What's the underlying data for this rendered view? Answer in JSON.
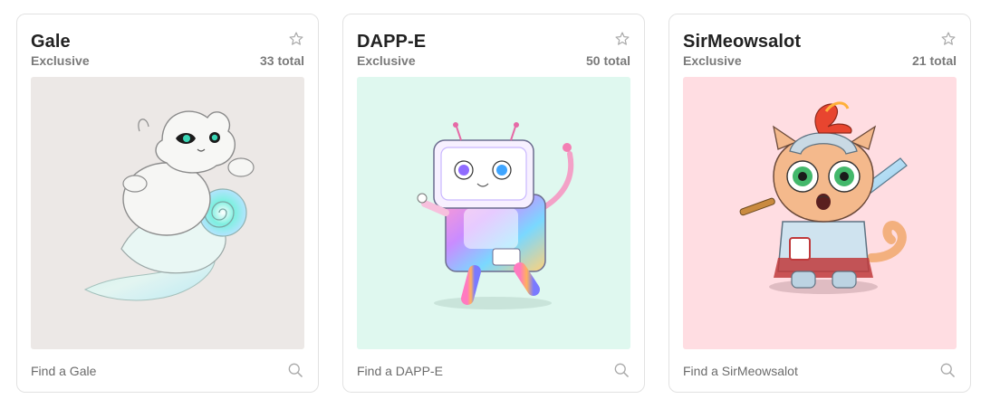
{
  "cards": [
    {
      "name": "Gale",
      "rarity": "Exclusive",
      "total": "33 total",
      "find_label": "Find a Gale",
      "background": "#ece8e6",
      "star_icon": "star-outline-icon",
      "search_icon": "search-icon"
    },
    {
      "name": "DAPP-E",
      "rarity": "Exclusive",
      "total": "50 total",
      "find_label": "Find a DAPP-E",
      "background": "#dff8ef",
      "star_icon": "star-outline-icon",
      "search_icon": "search-icon"
    },
    {
      "name": "SirMeowsalot",
      "rarity": "Exclusive",
      "total": "21 total",
      "find_label": "Find a SirMeowsalot",
      "background": "#ffdde2",
      "star_icon": "star-outline-icon",
      "search_icon": "search-icon"
    }
  ]
}
